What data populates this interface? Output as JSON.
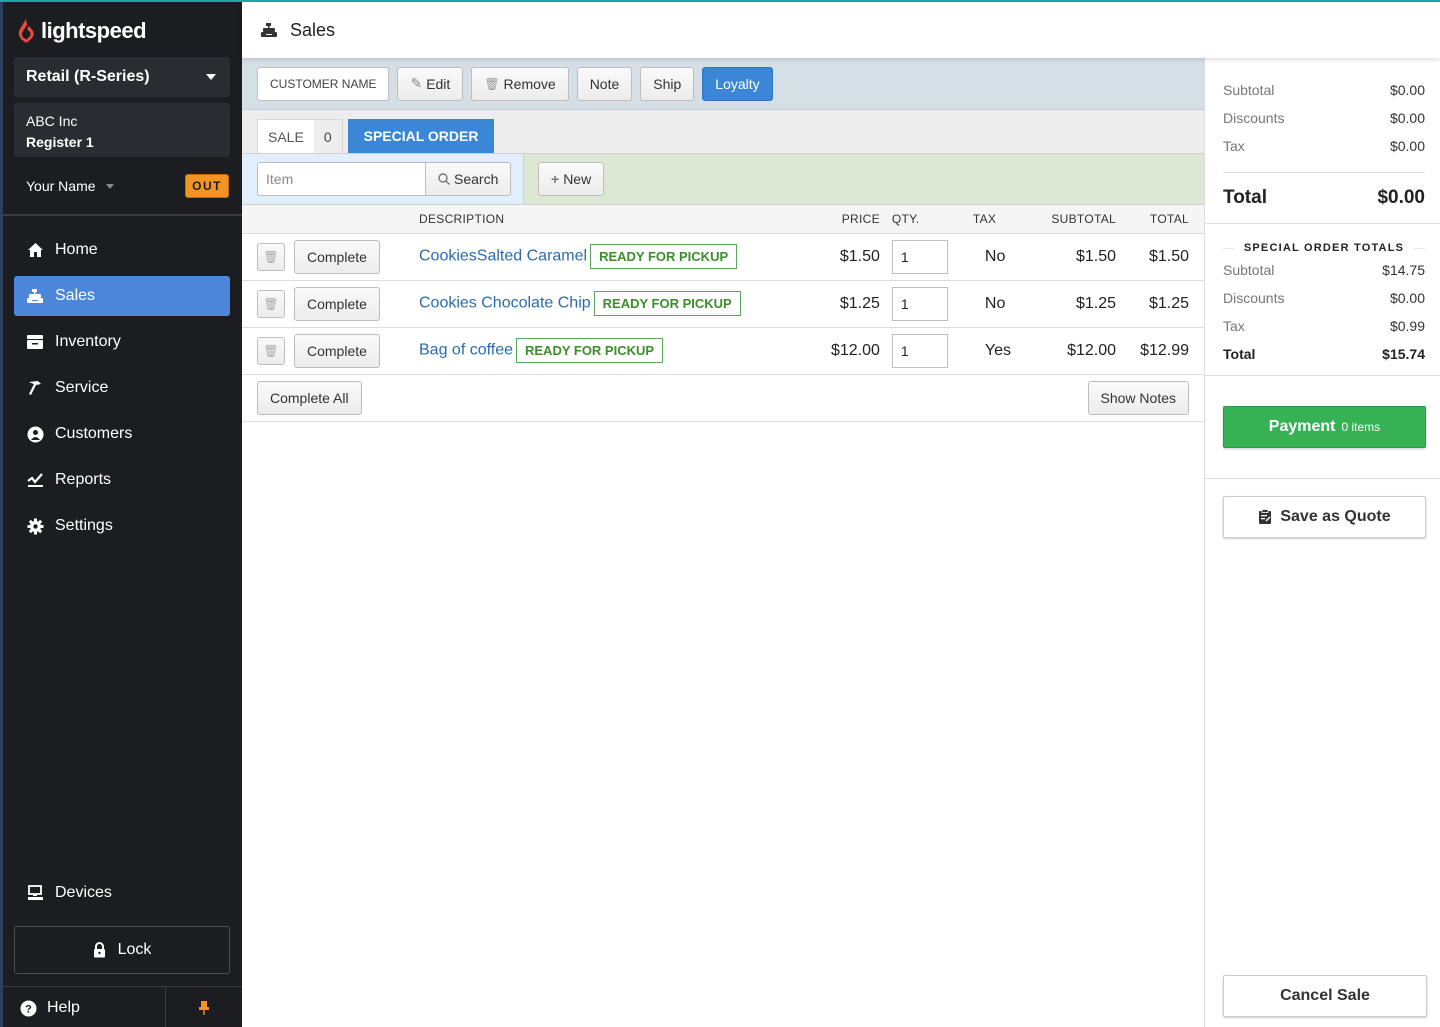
{
  "brand": {
    "name": "lightspeed",
    "accent": "#e84a3d"
  },
  "sidebar": {
    "store_select": "Retail (R-Series)",
    "company": "ABC Inc",
    "register": "Register 1",
    "user_name": "Your Name",
    "out_badge": "OUT",
    "nav": [
      {
        "label": "Home",
        "icon": "home-icon"
      },
      {
        "label": "Sales",
        "icon": "cash-register-icon",
        "active": true
      },
      {
        "label": "Inventory",
        "icon": "inventory-box-icon"
      },
      {
        "label": "Service",
        "icon": "hammer-icon"
      },
      {
        "label": "Customers",
        "icon": "user-circle-icon"
      },
      {
        "label": "Reports",
        "icon": "chart-line-icon"
      },
      {
        "label": "Settings",
        "icon": "gear-icon"
      }
    ],
    "devices": "Devices",
    "lock": "Lock",
    "help": "Help"
  },
  "header": {
    "title": "Sales"
  },
  "toolbar": {
    "customer_name": "CUSTOMER NAME",
    "edit": "Edit",
    "remove": "Remove",
    "note": "Note",
    "ship": "Ship",
    "loyalty": "Loyalty"
  },
  "tabs": {
    "sale_label": "SALE",
    "sale_count": "0",
    "special_order": "SPECIAL ORDER"
  },
  "search": {
    "placeholder": "Item",
    "search_label": "Search",
    "new_label": "New"
  },
  "table": {
    "headers": {
      "description": "DESCRIPTION",
      "price": "PRICE",
      "qty": "QTY.",
      "tax": "TAX",
      "subtotal": "SUBTOTAL",
      "total": "TOTAL"
    },
    "complete_label": "Complete",
    "rows": [
      {
        "description": "CookiesSalted Caramel",
        "status": "READY FOR PICKUP",
        "price": "$1.50",
        "qty": "1",
        "tax": "No",
        "subtotal": "$1.50",
        "total": "$1.50"
      },
      {
        "description": "Cookies Chocolate Chip",
        "status": "READY FOR PICKUP",
        "price": "$1.25",
        "qty": "1",
        "tax": "No",
        "subtotal": "$1.25",
        "total": "$1.25"
      },
      {
        "description": "Bag of coffee",
        "status": "READY FOR PICKUP",
        "price": "$12.00",
        "qty": "1",
        "tax": "Yes",
        "subtotal": "$12.00",
        "total": "$12.99"
      }
    ],
    "complete_all": "Complete All",
    "show_notes": "Show Notes"
  },
  "summary": {
    "subtotal_label": "Subtotal",
    "subtotal": "$0.00",
    "discounts_label": "Discounts",
    "discounts": "$0.00",
    "tax_label": "Tax",
    "tax": "$0.00",
    "total_label": "Total",
    "total": "$0.00"
  },
  "special_order_totals": {
    "title": "SPECIAL ORDER TOTALS",
    "subtotal_label": "Subtotal",
    "subtotal": "$14.75",
    "discounts_label": "Discounts",
    "discounts": "$0.00",
    "tax_label": "Tax",
    "tax": "$0.99",
    "total_label": "Total",
    "total": "$15.74"
  },
  "actions": {
    "payment": "Payment",
    "payment_items": "0 items",
    "save_quote": "Save as Quote",
    "cancel_sale": "Cancel Sale"
  },
  "colors": {
    "primary_blue": "#3b86d6",
    "payment_green": "#36b255",
    "status_green": "#3a8f2a",
    "out_orange": "#f29423"
  }
}
